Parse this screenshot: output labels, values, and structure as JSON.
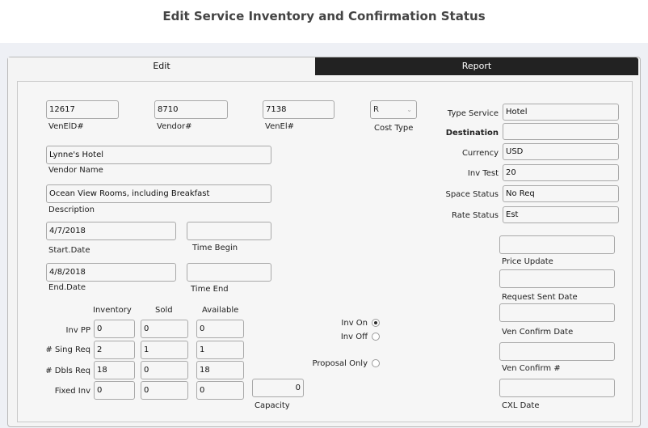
{
  "page": {
    "title": "Edit Service Inventory and Confirmation Status"
  },
  "tabs": {
    "edit": "Edit",
    "report": "Report"
  },
  "ids": {
    "venelid": {
      "value": "12617",
      "label": "VenElD#"
    },
    "vendor": {
      "value": "8710",
      "label": "Vendor#"
    },
    "venel": {
      "value": "7138",
      "label": "VenEl#"
    },
    "cost_type": {
      "value": "R",
      "label": "Cost Type"
    }
  },
  "vendor_name": {
    "value": "Lynne's Hotel",
    "label": "Vendor Name"
  },
  "description": {
    "value": "Ocean View Rooms, including Breakfast",
    "label": "Description"
  },
  "start_date": {
    "value": "4/7/2018",
    "label": "Start.Date"
  },
  "time_begin": {
    "value": "",
    "label": "Time Begin"
  },
  "end_date": {
    "value": "4/8/2018",
    "label": "End.Date"
  },
  "time_end": {
    "value": "",
    "label": "Time End"
  },
  "inventory": {
    "headers": {
      "inventory": "Inventory",
      "sold": "Sold",
      "available": "Available"
    },
    "rows": [
      {
        "label": "Inv PP",
        "inventory": "0",
        "sold": "0",
        "available": "0"
      },
      {
        "label": "# Sing Req",
        "inventory": "2",
        "sold": "1",
        "available": "1"
      },
      {
        "label": "# Dbls Req",
        "inventory": "18",
        "sold": "0",
        "available": "18"
      },
      {
        "label": "Fixed Inv",
        "inventory": "0",
        "sold": "0",
        "available": "0"
      }
    ],
    "capacity": {
      "value": "0",
      "label": "Capacity"
    }
  },
  "options": {
    "inv_on": {
      "label": "Inv On",
      "checked": true
    },
    "inv_off": {
      "label": "Inv Off",
      "checked": false
    },
    "proposal_only": {
      "label": "Proposal Only",
      "checked": false
    }
  },
  "right": {
    "type_service": {
      "label": "Type Service",
      "value": "Hotel"
    },
    "destination": {
      "label": "Destination",
      "value": ""
    },
    "currency": {
      "label": "Currency",
      "value": "USD"
    },
    "inv_test": {
      "label": "Inv Test",
      "value": "20"
    },
    "space_status": {
      "label": "Space Status",
      "value": "No Req"
    },
    "rate_status": {
      "label": "Rate Status",
      "value": "Est"
    }
  },
  "dates": {
    "price_update": {
      "label": "Price Update",
      "value": ""
    },
    "request_sent_date": {
      "label": "Request Sent Date",
      "value": ""
    },
    "ven_confirm_date": {
      "label": "Ven Confirm Date",
      "value": ""
    },
    "ven_confirm_no": {
      "label": "Ven Confirm #",
      "value": ""
    },
    "cxl_date": {
      "label": "CXL Date",
      "value": ""
    }
  }
}
